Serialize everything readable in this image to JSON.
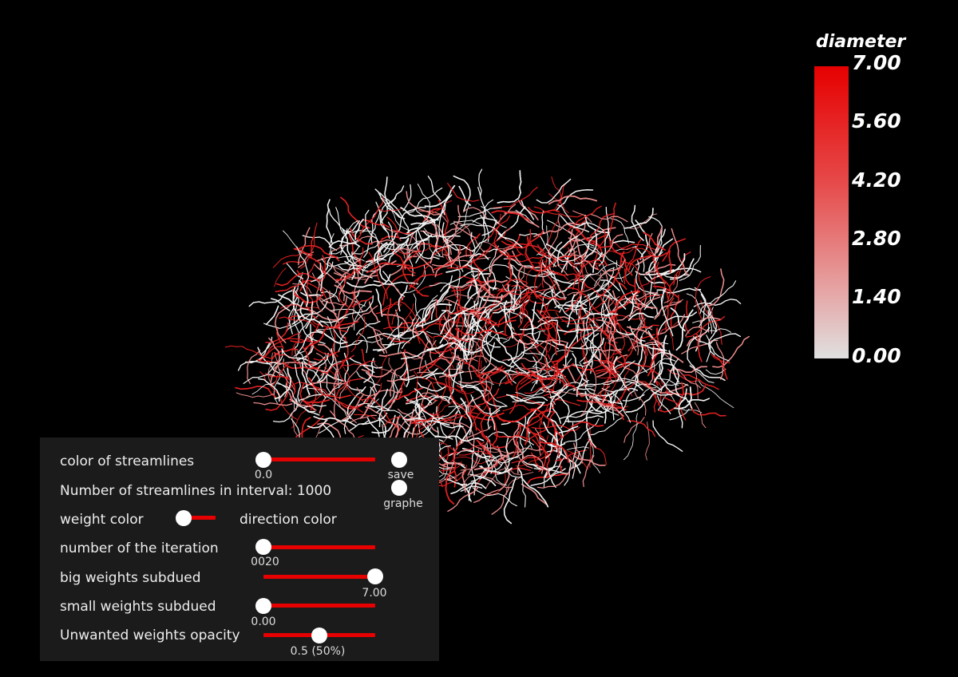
{
  "legend": {
    "title": "diameter",
    "ticks": [
      "7.00",
      "5.60",
      "4.20",
      "2.80",
      "1.40",
      "0.00"
    ]
  },
  "panel": {
    "color_streamlines": {
      "label": "color of streamlines",
      "value": "0.0"
    },
    "save_label": "save",
    "graphe_label": "graphe",
    "streamline_count_text": "Number of streamlines in interval: 1000",
    "color_mode": {
      "left_label": "weight color",
      "right_label": "direction color"
    },
    "iteration": {
      "label": "number of the iteration",
      "value": "0020"
    },
    "big_weights": {
      "label": "big weights subdued",
      "value": "7.00"
    },
    "small_weights": {
      "label": "small weights subdued",
      "value": "0.00"
    },
    "opacity": {
      "label": "Unwanted weights opacity",
      "value": "0.5 (50%)"
    }
  }
}
